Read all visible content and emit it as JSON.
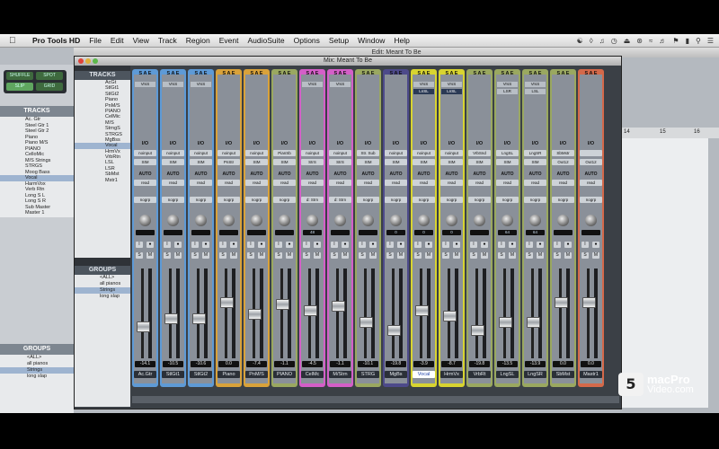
{
  "menubar": {
    "apple": "",
    "app": "Pro Tools HD",
    "items": [
      "File",
      "Edit",
      "View",
      "Track",
      "Region",
      "Event",
      "AudioSuite",
      "Options",
      "Setup",
      "Window",
      "Help"
    ]
  },
  "edit_window": {
    "title": "Edit: Meant To Be",
    "shuffle": "SHUFFLE",
    "spot": "SPOT",
    "slip": "SLIP",
    "grid": "GRID",
    "tracks_header": "TRACKS",
    "tracks": [
      "Ac. Gtr",
      "Steel Gtr 1",
      "Steel Gtr 2",
      "Piano",
      "Piano M/S",
      "PIANO",
      "CelloMic",
      "M/S Strings",
      "STRGS",
      "Moog Bass",
      "Vocal",
      "HarmVox",
      "Verb Rtn",
      "Long S L",
      "Long S R",
      "Sub Master",
      "Master 1"
    ],
    "groups_header": "GROUPS",
    "groups": [
      "<ALL>",
      "all pianos",
      "Strings",
      "long slap"
    ],
    "ruler": [
      "14",
      "15",
      "16"
    ]
  },
  "mix_window": {
    "title": "Mix: Meant To Be",
    "tracks_header": "TRACKS",
    "tracks": [
      "AcGt",
      "StlGt1",
      "StlGt2",
      "Piano",
      "PnM/S",
      "PIANO",
      "CelMic",
      "M/S",
      "StrngS",
      "STRGS",
      "MgBss",
      "Vocal",
      "HrmVx",
      "VrbRtn",
      "LSL",
      "LSR",
      "SbMst",
      "Mstr1"
    ],
    "groups_header": "GROUPS",
    "groups": [
      "<ALL>",
      "all pianos",
      "Strings",
      "long slap"
    ],
    "strip_header": "S A E",
    "io_label": "I/O",
    "auto_label": "AUTO",
    "read_label": "read",
    "channels": [
      {
        "name": "Ac.Gtr",
        "color": "#5e9ad6",
        "inserts": [
          "VrsS"
        ],
        "input": "noinput",
        "output": "StM",
        "group": "nogrp",
        "pan": "",
        "vol": "-14.1",
        "fader": 0.35,
        "sel": false
      },
      {
        "name": "StlGt1",
        "color": "#5e9ad6",
        "inserts": [
          "VrsS"
        ],
        "input": "noinput",
        "output": "StM",
        "group": "nogrp",
        "pan": "",
        "vol": "-10.5",
        "fader": 0.45,
        "sel": false
      },
      {
        "name": "StlGt2",
        "color": "#5e9ad6",
        "inserts": [
          "VrsS"
        ],
        "input": "noinput",
        "output": "StM",
        "group": "nogrp",
        "pan": "",
        "vol": "-10.6",
        "fader": 0.45,
        "sel": false
      },
      {
        "name": "Piano",
        "color": "#d9a23a",
        "inserts": [],
        "input": "noinput",
        "output": "PnStr",
        "group": "nogrp",
        "pan": "",
        "vol": "0.0",
        "fader": 0.65,
        "sel": false
      },
      {
        "name": "PnM/S",
        "color": "#d9a23a",
        "inserts": [],
        "input": "noinput",
        "output": "StM",
        "group": "nogrp",
        "pan": "",
        "vol": "-7.4",
        "fader": 0.5,
        "sel": false
      },
      {
        "name": "PIANO",
        "color": "#9aa860",
        "inserts": [],
        "input": "PianSb",
        "output": "StM",
        "group": "nogrp",
        "pan": "",
        "vol": "-1.1",
        "fader": 0.62,
        "sel": false
      },
      {
        "name": "CelMc",
        "color": "#d45fc8",
        "inserts": [
          "VrsS"
        ],
        "input": "noinput",
        "output": "StrS",
        "group": "d: Strn",
        "pan": "48",
        "vol": "-4.5",
        "fader": 0.55,
        "sel": false
      },
      {
        "name": "M/Strn",
        "color": "#d45fc8",
        "inserts": [
          "VrsS"
        ],
        "input": "noinput",
        "output": "StrS",
        "group": "d: Strn",
        "pan": "",
        "vol": "-1.1",
        "fader": 0.6,
        "sel": false
      },
      {
        "name": "STRG",
        "color": "#9aa860",
        "inserts": [],
        "input": "Str. Sub",
        "output": "StM",
        "group": "nogrp",
        "pan": "",
        "vol": "-10.1",
        "fader": 0.4,
        "sel": false
      },
      {
        "name": "MgBs",
        "color": "#4d4a8a",
        "inserts": [],
        "input": "noinput",
        "output": "StM",
        "group": "nogrp",
        "pan": "0",
        "vol": "-19.8",
        "fader": 0.3,
        "sel": false
      },
      {
        "name": "Vocal",
        "color": "#d8d430",
        "inserts": [
          "VrsS",
          "LnSL"
        ],
        "input": "noinput",
        "output": "StM",
        "group": "nogrp",
        "pan": "0",
        "vol": "-3.9",
        "fader": 0.55,
        "sel": true
      },
      {
        "name": "HrmVx",
        "color": "#d8d430",
        "inserts": [
          "VrsS",
          "LnSL"
        ],
        "input": "noinput",
        "output": "StM",
        "group": "nogrp",
        "pan": "0",
        "vol": "-8.7",
        "fader": 0.48,
        "sel": false
      },
      {
        "name": "VrbRt",
        "color": "#9aa860",
        "inserts": [],
        "input": "VrbSnd",
        "output": "StM",
        "group": "nogrp",
        "pan": "",
        "vol": "-19.8",
        "fader": 0.3,
        "sel": false
      },
      {
        "name": "LngSL",
        "color": "#9aa860",
        "inserts": [
          "VrsS",
          "LSR"
        ],
        "input": "LngSL",
        "output": "StM",
        "group": "nogrp",
        "pan": "64",
        "vol": "-13.5",
        "fader": 0.4,
        "sel": false
      },
      {
        "name": "LngSR",
        "color": "#9aa860",
        "inserts": [
          "VrsS",
          "LSL"
        ],
        "input": "LngSR",
        "output": "StM",
        "group": "nogrp",
        "pan": "64",
        "vol": "-13.9",
        "fader": 0.4,
        "sel": false
      },
      {
        "name": "SbMst",
        "color": "#9aa860",
        "inserts": [],
        "input": "SbMstr",
        "output": "Out12",
        "group": "nogrp",
        "pan": "",
        "vol": "0.0",
        "fader": 0.65,
        "sel": false
      },
      {
        "name": "Mastr1",
        "color": "#d4694a",
        "inserts": [],
        "input": "",
        "output": "Out12",
        "group": "nogrp",
        "pan": "",
        "vol": "0.0",
        "fader": 0.65,
        "sel": false
      }
    ]
  },
  "logo": {
    "line1": "macPro",
    "line2": "Video.com"
  }
}
